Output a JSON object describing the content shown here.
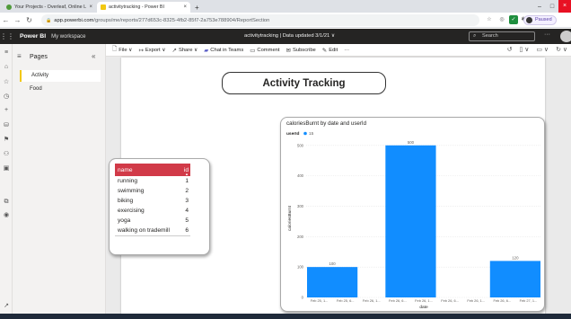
{
  "browser": {
    "tabs": [
      {
        "label": "Your Projects - Overleaf, Online L",
        "color": "#4f9a3b"
      },
      {
        "label": "activitytracking - Power BI",
        "color": "#f2c811"
      }
    ],
    "new_tab_glyph": "+",
    "url_host": "app.powerbi.com",
    "url_path": "/groups/me/reports/277d653c-8325-4fb2-85f7-2a753e788904/ReportSection",
    "paused_label": "Paused"
  },
  "pbi_header": {
    "app_name": "Power BI",
    "workspace": "My workspace",
    "report_title": "activitytracking | Data updated 3/1/21 ∨",
    "search_placeholder": "Search"
  },
  "pages_pane": {
    "title": "Pages",
    "items": [
      {
        "label": "Activity",
        "active": true
      },
      {
        "label": "Food",
        "active": false
      }
    ]
  },
  "toolbar": {
    "file": "File ∨",
    "export": "Export ∨",
    "share": "Share ∨",
    "chat": "Chat in Teams",
    "comment": "Comment",
    "subscribe": "Subscribe",
    "edit": "Edit",
    "more": "···"
  },
  "report": {
    "title": "Activity Tracking",
    "table": {
      "columns": [
        "name",
        "id"
      ],
      "rows": [
        [
          "running",
          "1"
        ],
        [
          "swimming",
          "2"
        ],
        [
          "biking",
          "3"
        ],
        [
          "exercising",
          "4"
        ],
        [
          "yoga",
          "5"
        ],
        [
          "walking on trademill",
          "6"
        ]
      ]
    }
  },
  "chart_data": {
    "type": "bar",
    "title": "caloriesBurnt by date and userId",
    "legend_title": "userId",
    "legend_position": "top-left",
    "xlabel": "date",
    "ylabel": "caloriesBurnt",
    "ylim": [
      0,
      520
    ],
    "yticks": [
      0,
      100,
      200,
      300,
      400,
      500
    ],
    "grid": true,
    "categories": [
      "Feb 25, 1...",
      "Feb 25, 6...",
      "Feb 26, 1...",
      "Feb 26, 6...",
      "Feb 26, 1...",
      "Feb 26, 6...",
      "Feb 26, 1...",
      "Feb 26, 6...",
      "Feb 27, 1..."
    ],
    "series": [
      {
        "name": "15",
        "color": "#118dff",
        "bars": [
          {
            "from": 0,
            "to": 2,
            "value": 100
          },
          {
            "from": 3,
            "to": 5,
            "value": 500
          },
          {
            "from": 7,
            "to": 9,
            "value": 120
          }
        ]
      }
    ]
  }
}
